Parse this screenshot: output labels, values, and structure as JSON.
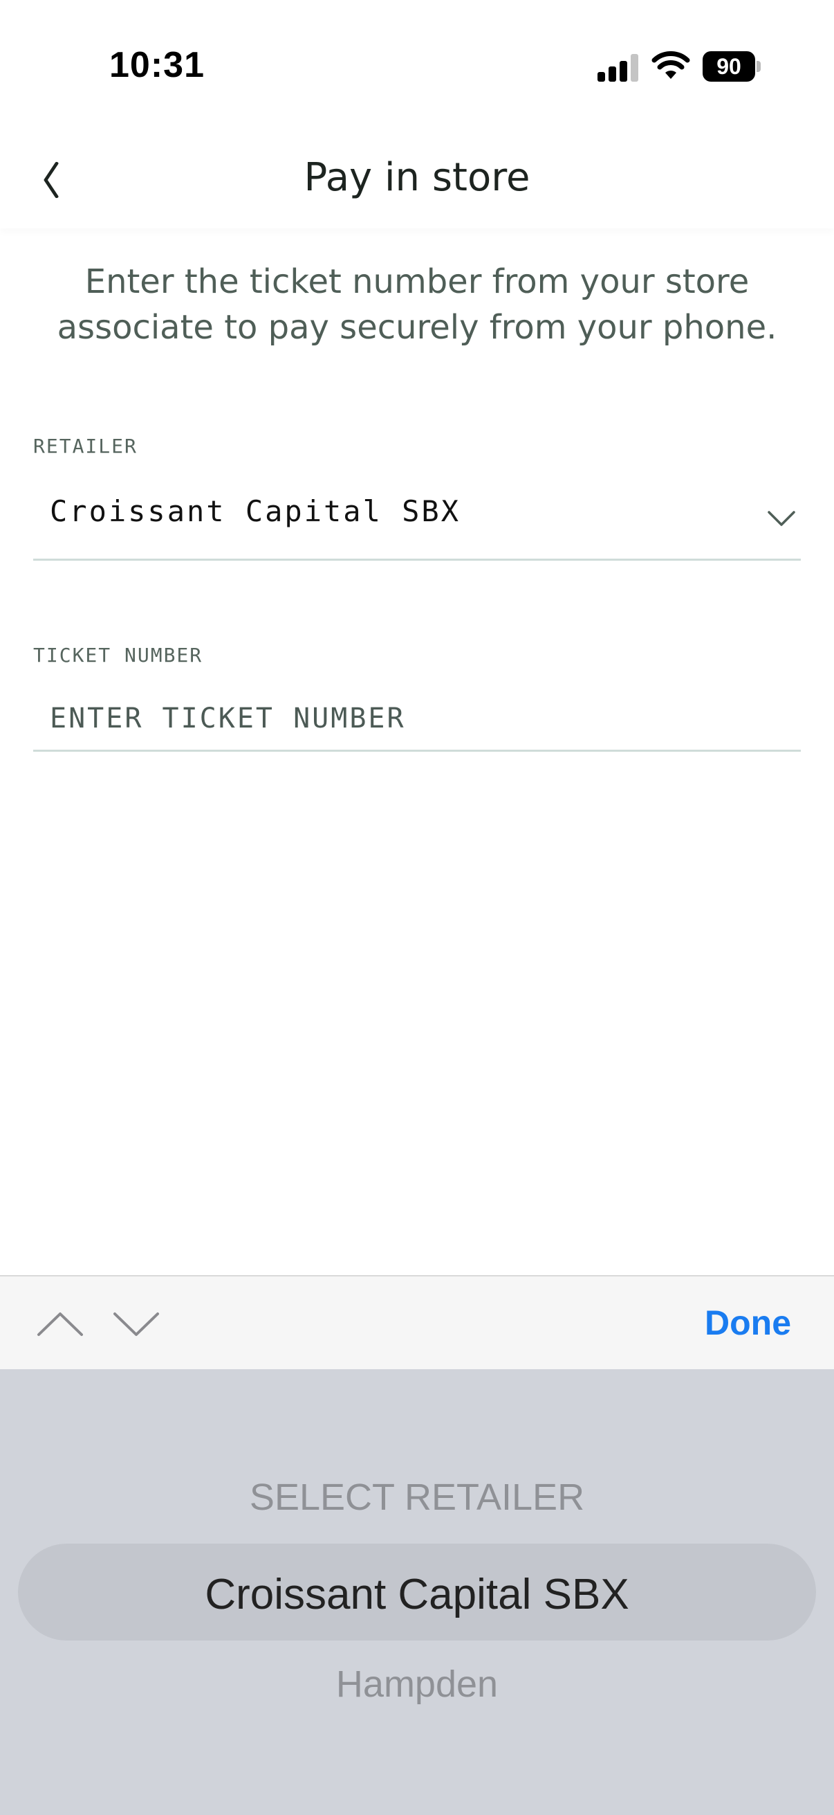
{
  "status_bar": {
    "time": "10:31",
    "battery": "90",
    "icons": [
      "signal-icon",
      "wifi-icon",
      "battery-icon"
    ]
  },
  "nav": {
    "title": "Pay in store",
    "back_icon": "chevron-left-icon"
  },
  "intro": {
    "line1": "Enter the ticket number from your store",
    "line2": "associate to pay securely from your phone."
  },
  "retailer_field": {
    "label": "RETAILER",
    "value": "Croissant Capital SBX",
    "icon": "chevron-down-icon"
  },
  "ticket_field": {
    "label": "TICKET NUMBER",
    "value": "",
    "placeholder": "ENTER TICKET NUMBER"
  },
  "accessory_bar": {
    "done_label": "Done",
    "previous_icon": "chevron-up-icon",
    "next_icon": "chevron-down-icon"
  },
  "picker": {
    "options": [
      "SELECT RETAILER",
      "Croissant Capital SBX",
      "Hampden"
    ],
    "selected": "Croissant Capital SBX"
  },
  "colors": {
    "accent": "#1a7cf0",
    "text_muted": "#4f5e57",
    "divider": "#cfdcd9",
    "picker_bg": "#d0d3da"
  }
}
